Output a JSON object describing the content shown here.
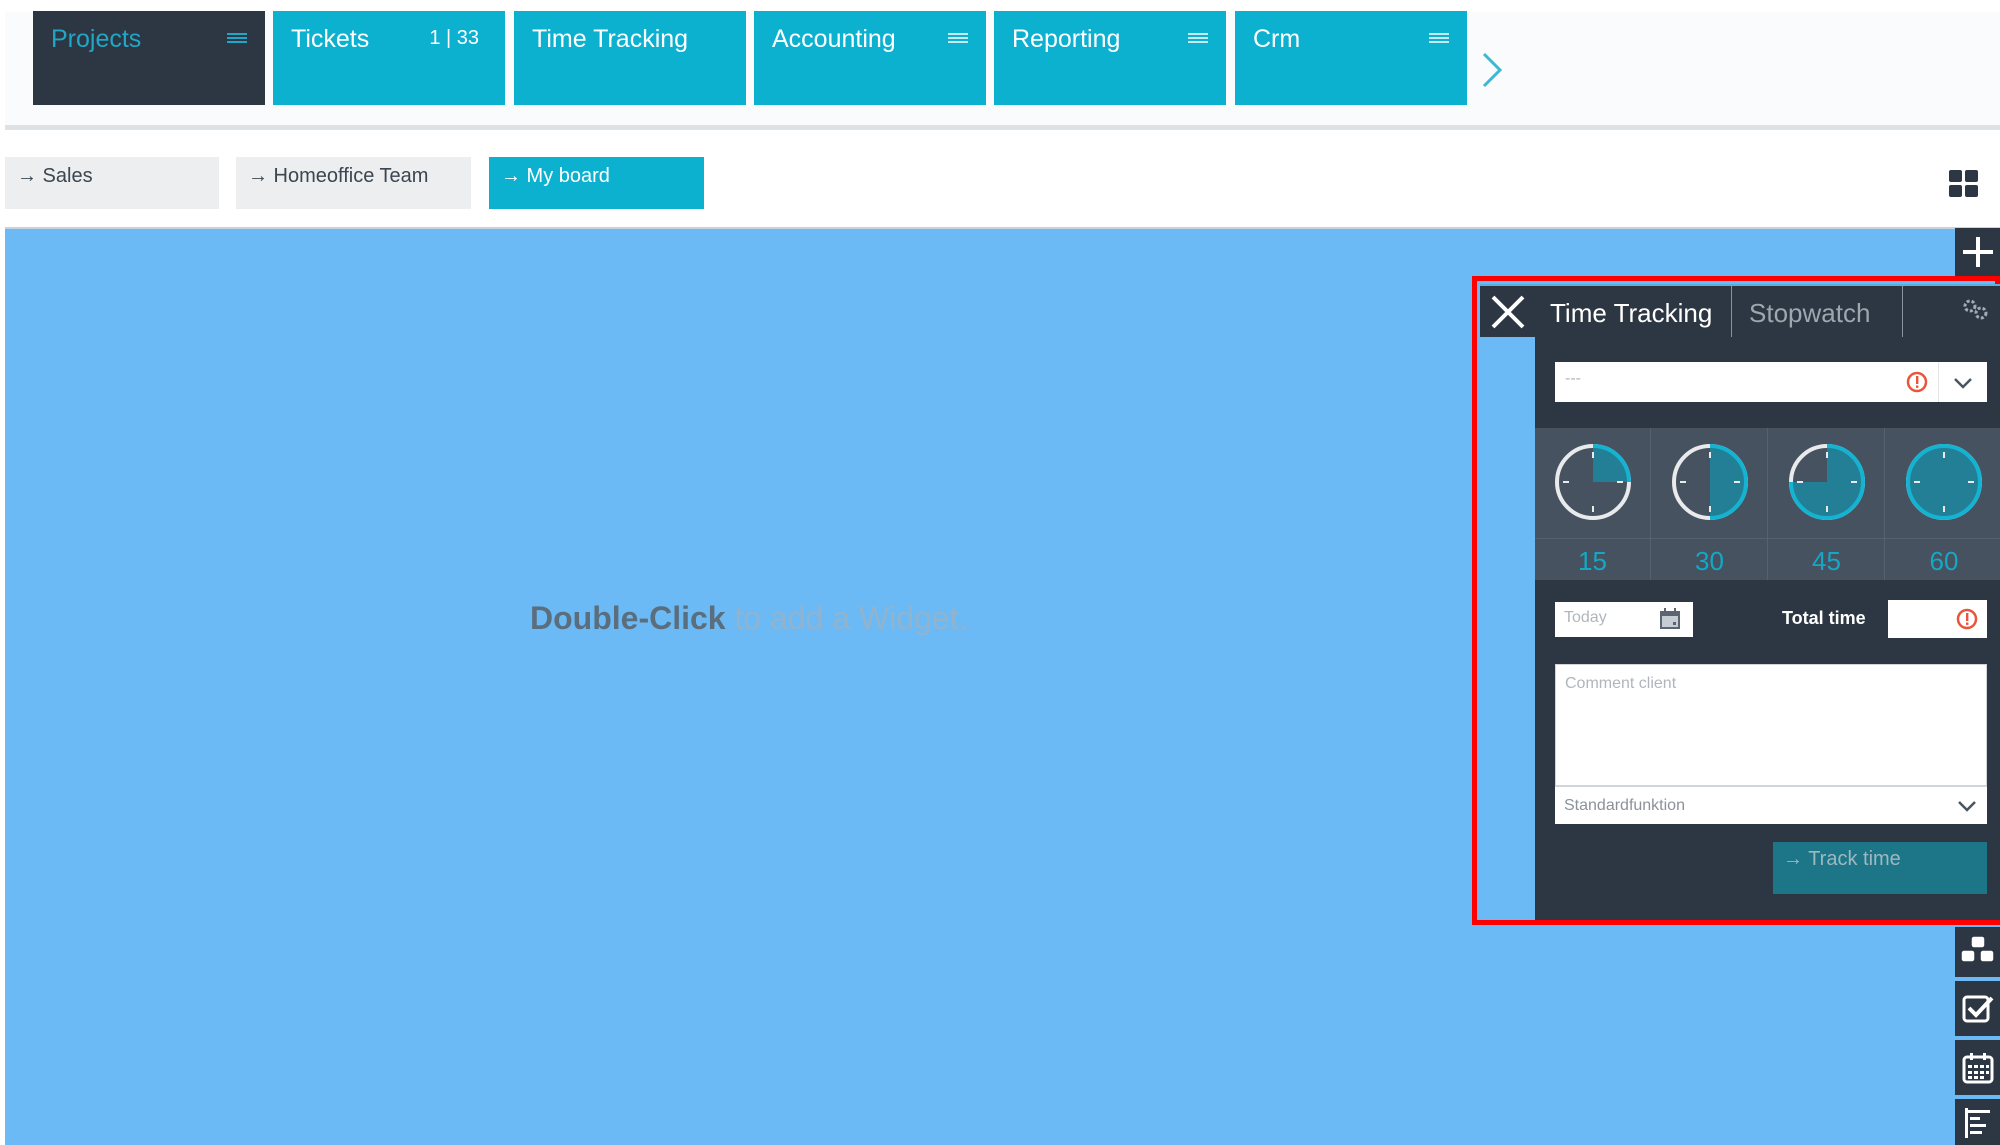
{
  "modules": {
    "tabs": [
      {
        "label": "Projects",
        "active": true,
        "has_menu": true
      },
      {
        "label": "Tickets",
        "count": "1 | 33",
        "active": false,
        "has_menu": false
      },
      {
        "label": "Time Tracking",
        "active": false,
        "has_menu": false
      },
      {
        "label": "Accounting",
        "active": false,
        "has_menu": true
      },
      {
        "label": "Reporting",
        "active": false,
        "has_menu": true
      },
      {
        "label": "Crm",
        "active": false,
        "has_menu": true
      }
    ],
    "next_icon": "chevron-right-icon"
  },
  "boards": {
    "items": [
      {
        "label": "→ Sales",
        "active": false
      },
      {
        "label": "→ Homeoffice Team",
        "active": false
      },
      {
        "label": "→ My board",
        "active": true
      }
    ],
    "layout_icon": "grid-icon"
  },
  "canvas": {
    "hint_strong": "Double-Click",
    "hint_weak": " to add a Widget."
  },
  "widget": {
    "tabs": [
      {
        "label": "Time Tracking",
        "active": true
      },
      {
        "label": "Stopwatch",
        "active": false
      }
    ],
    "project_select": {
      "placeholder": "---"
    },
    "presets": [
      {
        "label": "15",
        "fraction": 0.25
      },
      {
        "label": "30",
        "fraction": 0.5
      },
      {
        "label": "45",
        "fraction": 0.75
      },
      {
        "label": "60",
        "fraction": 1.0
      }
    ],
    "date_field": {
      "placeholder": "Today"
    },
    "total_time": {
      "label": "Total time",
      "value": ""
    },
    "comment": {
      "placeholder": "Comment client"
    },
    "function_select": {
      "value": "Standardfunktion"
    },
    "track_button": "→ Track time"
  },
  "rail": {
    "icons": [
      "plus-icon",
      "cubes-icon",
      "checkbox-icon",
      "calendar-icon",
      "gantt-icon"
    ]
  },
  "colors": {
    "accent": "#0db1d0",
    "dark": "#2d3743",
    "canvas": "#6bbaf5",
    "highlight": "#ff0000",
    "warning": "#e8553a"
  }
}
